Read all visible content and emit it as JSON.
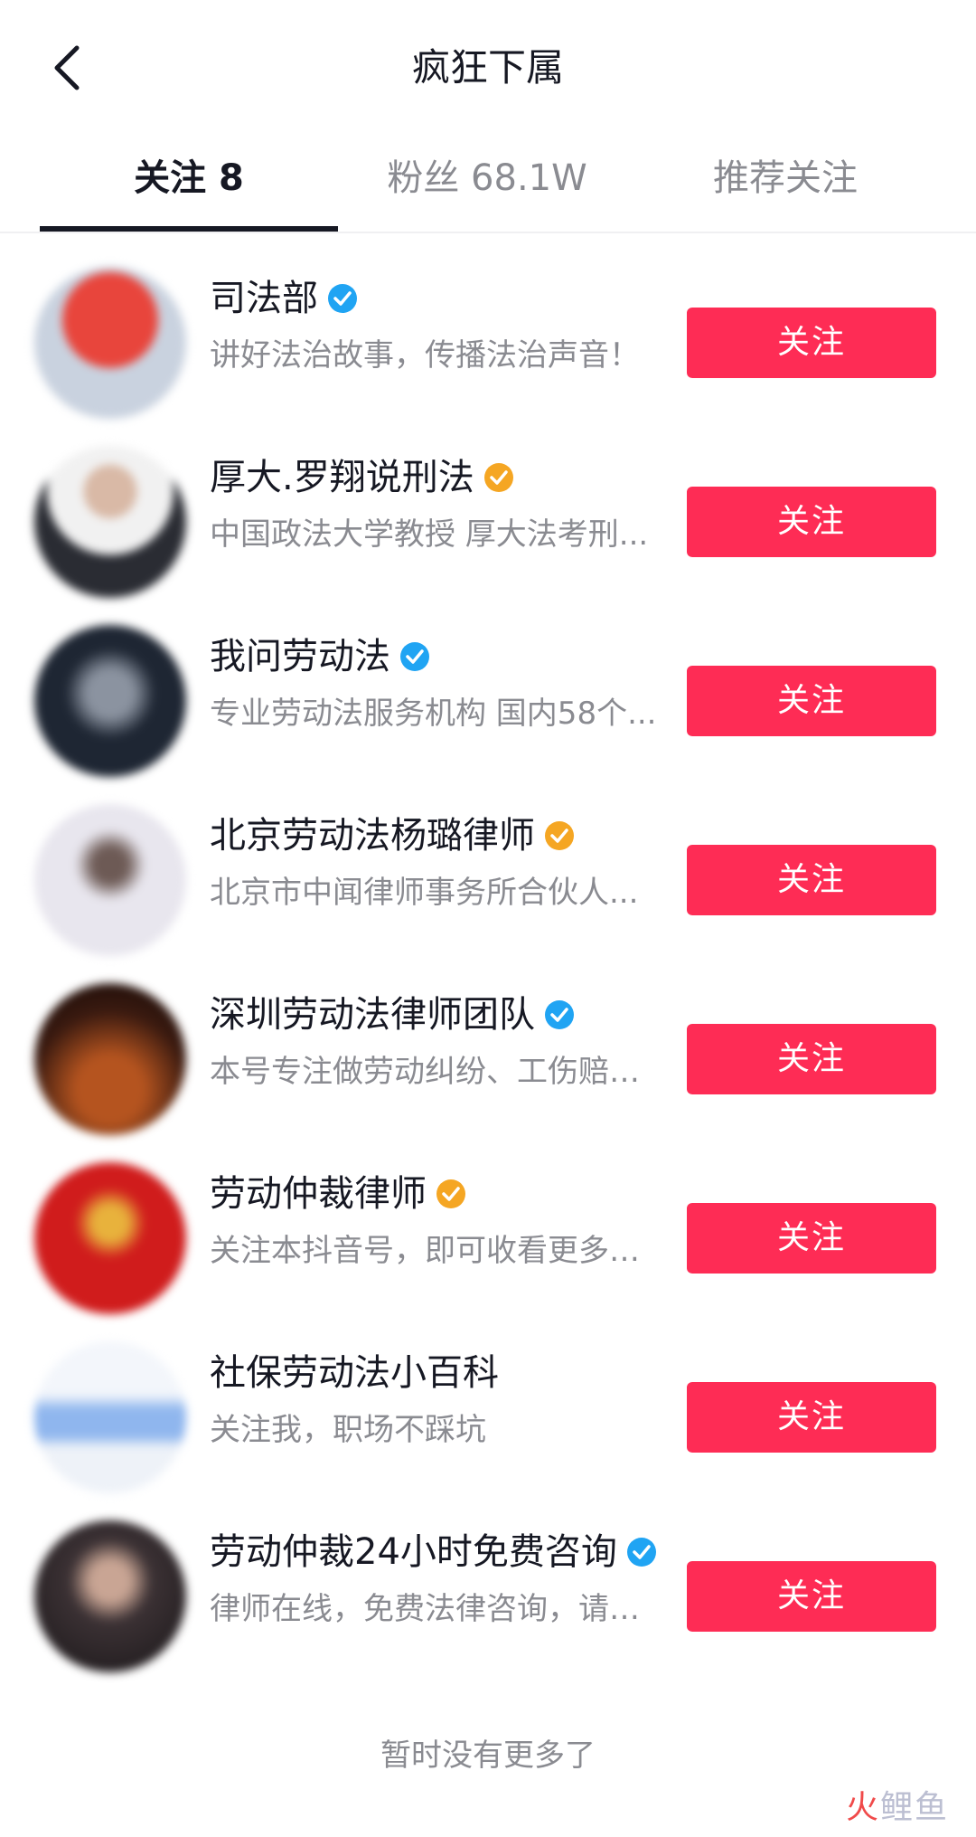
{
  "header": {
    "title": "疯狂下属"
  },
  "tabs": [
    {
      "label": "关注 8",
      "active": true
    },
    {
      "label": "粉丝 68.1W",
      "active": false
    },
    {
      "label": "推荐关注",
      "active": false
    }
  ],
  "colors": {
    "accent": "#fe2c55",
    "verified_blue": "#20a4f3",
    "verified_gold": "#f5a623"
  },
  "list": [
    {
      "name": "司法部",
      "desc": "讲好法治故事，传播法治声音！",
      "badge": "blue",
      "follow_label": "关注"
    },
    {
      "name": "厚大.罗翔说刑法",
      "desc": "中国政法大学教授 厚大法考刑...",
      "badge": "gold",
      "follow_label": "关注"
    },
    {
      "name": "我问劳动法",
      "desc": "专业劳动法服务机构 国内58个...",
      "badge": "blue",
      "follow_label": "关注"
    },
    {
      "name": "北京劳动法杨璐律师",
      "desc": "北京市中闻律师事务所合伙人...",
      "badge": "gold",
      "follow_label": "关注"
    },
    {
      "name": "深圳劳动法律师团队",
      "desc": "本号专注做劳动纠纷、工伤赔偿...",
      "badge": "blue",
      "follow_label": "关注"
    },
    {
      "name": "劳动仲裁律师",
      "desc": "关注本抖音号，即可收看更多劳...",
      "badge": "gold",
      "follow_label": "关注"
    },
    {
      "name": "社保劳动法小百科",
      "desc": "关注我，职场不踩坑",
      "badge": "none",
      "follow_label": "关注"
    },
    {
      "name": "劳动仲裁24小时免费咨询",
      "desc": "律师在线，免费法律咨询，请【...",
      "badge": "blue",
      "follow_label": "关注"
    }
  ],
  "footer": {
    "note": "暂时没有更多了"
  },
  "watermark": {
    "part1": "火",
    "part2": "鲤鱼"
  }
}
